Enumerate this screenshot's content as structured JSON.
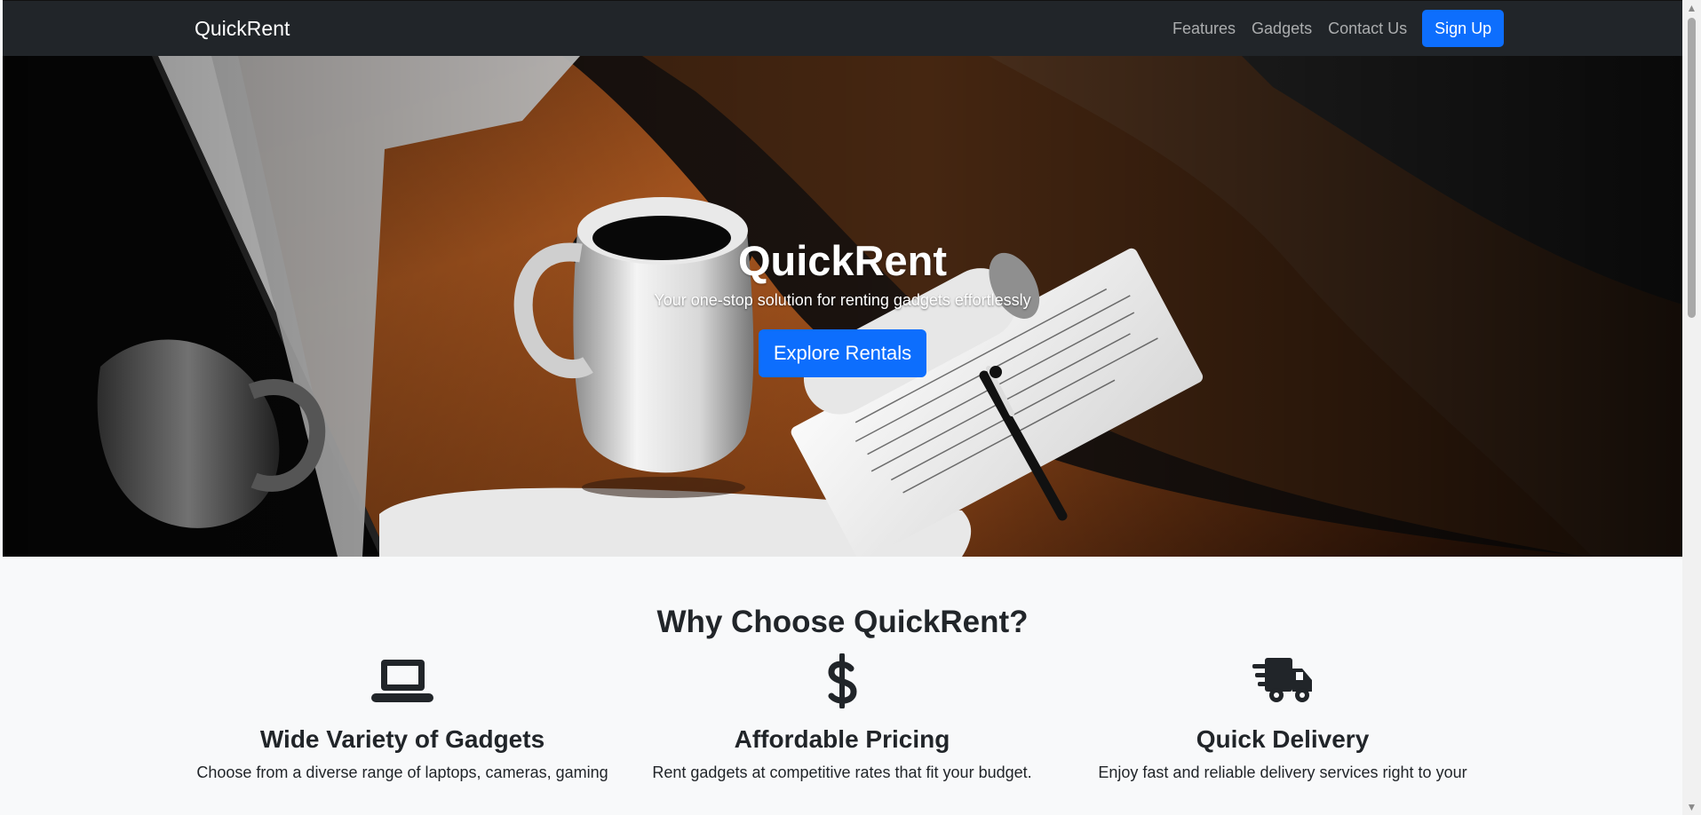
{
  "navbar": {
    "brand": "QuickRent",
    "links": [
      "Features",
      "Gadgets",
      "Contact Us"
    ],
    "signup": "Sign Up"
  },
  "hero": {
    "title": "QuickRent",
    "subtitle": "Your one-stop solution for renting gadgets effortlessly",
    "button": "Explore Rentals"
  },
  "features": {
    "title": "Why Choose QuickRent?",
    "items": [
      {
        "icon": "laptop-icon",
        "title": "Wide Variety of Gadgets",
        "text": "Choose from a diverse range of laptops, cameras, gaming"
      },
      {
        "icon": "dollar-icon",
        "title": "Affordable Pricing",
        "text": "Rent gadgets at competitive rates that fit your budget."
      },
      {
        "icon": "delivery-truck-icon",
        "title": "Quick Delivery",
        "text": "Enjoy fast and reliable delivery services right to your"
      }
    ]
  },
  "colors": {
    "navbar": "#212529",
    "primary": "#0d6efd",
    "background": "#f8f9fa",
    "text": "#212529"
  },
  "scrollbar": {
    "arrow_up": "▲",
    "arrow_down": "▼"
  }
}
